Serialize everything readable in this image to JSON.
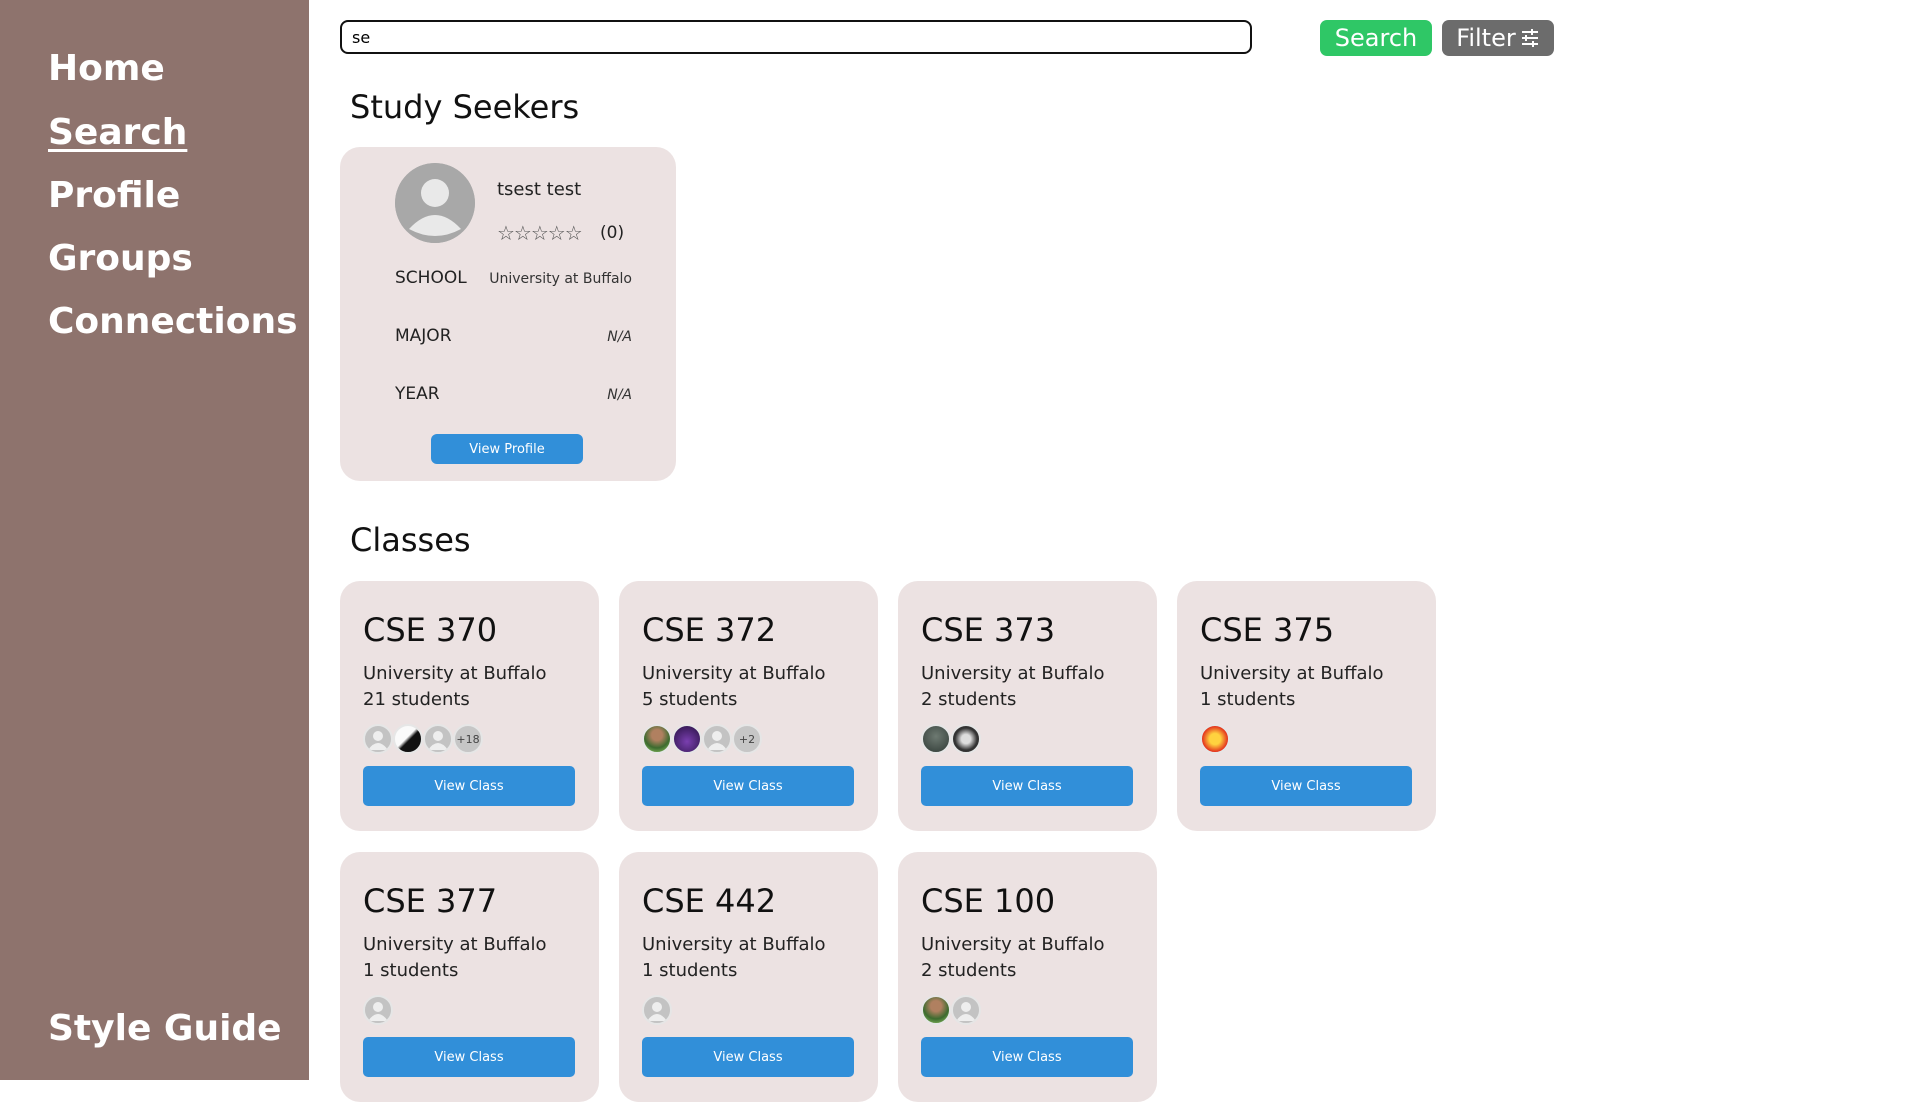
{
  "sidebar": {
    "items": [
      {
        "label": "Home"
      },
      {
        "label": "Search",
        "active": true
      },
      {
        "label": "Profile"
      },
      {
        "label": "Groups"
      },
      {
        "label": "Connections"
      }
    ],
    "bottom_items": [
      {
        "label": "Style Guide"
      }
    ]
  },
  "search": {
    "value": "se",
    "button_label": "Search",
    "filter_label": "Filter",
    "filter_icon": "sliders-icon"
  },
  "seekers": {
    "title": "Study Seekers",
    "items": [
      {
        "name": "tsest test",
        "stars": "☆☆☆☆☆",
        "rating_count": "(0)",
        "school_label": "SCHOOL",
        "school": "University at Buffalo",
        "major_label": "MAJOR",
        "major": "N/A",
        "year_label": "YEAR",
        "year": "N/A",
        "button_label": "View Profile"
      }
    ]
  },
  "classes": {
    "title": "Classes",
    "items": [
      {
        "code": "CSE 370",
        "school": "University at Buffalo",
        "students": "21 students",
        "more": "+18",
        "button_label": "View Class"
      },
      {
        "code": "CSE 372",
        "school": "University at Buffalo",
        "students": "5 students",
        "more": "+2",
        "button_label": "View Class"
      },
      {
        "code": "CSE 373",
        "school": "University at Buffalo",
        "students": "2 students",
        "button_label": "View Class"
      },
      {
        "code": "CSE 375",
        "school": "University at Buffalo",
        "students": "1 students",
        "button_label": "View Class"
      },
      {
        "code": "CSE 377",
        "school": "University at Buffalo",
        "students": "1 students",
        "button_label": "View Class"
      },
      {
        "code": "CSE 442",
        "school": "University at Buffalo",
        "students": "1 students",
        "button_label": "View Class"
      },
      {
        "code": "CSE 100",
        "school": "University at Buffalo",
        "students": "2 students",
        "button_label": "View Class"
      }
    ]
  },
  "colors": {
    "sidebar": "#8e736d",
    "card": "#ece2e2",
    "search_button": "#2fc766",
    "filter_button": "#6c6c6c",
    "primary_button": "#318fd9"
  }
}
